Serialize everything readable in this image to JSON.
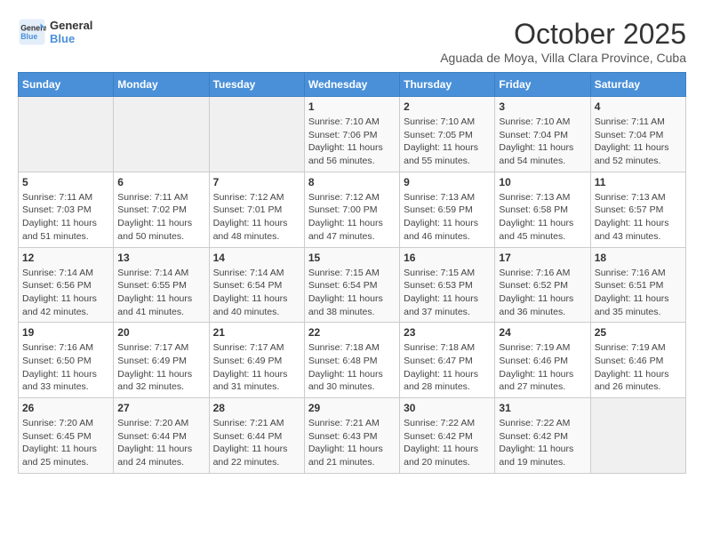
{
  "header": {
    "logo_line1": "General",
    "logo_line2": "Blue",
    "month": "October 2025",
    "location": "Aguada de Moya, Villa Clara Province, Cuba"
  },
  "weekdays": [
    "Sunday",
    "Monday",
    "Tuesday",
    "Wednesday",
    "Thursday",
    "Friday",
    "Saturday"
  ],
  "weeks": [
    [
      {
        "day": "",
        "info": ""
      },
      {
        "day": "",
        "info": ""
      },
      {
        "day": "",
        "info": ""
      },
      {
        "day": "1",
        "info": "Sunrise: 7:10 AM\nSunset: 7:06 PM\nDaylight: 11 hours\nand 56 minutes."
      },
      {
        "day": "2",
        "info": "Sunrise: 7:10 AM\nSunset: 7:05 PM\nDaylight: 11 hours\nand 55 minutes."
      },
      {
        "day": "3",
        "info": "Sunrise: 7:10 AM\nSunset: 7:04 PM\nDaylight: 11 hours\nand 54 minutes."
      },
      {
        "day": "4",
        "info": "Sunrise: 7:11 AM\nSunset: 7:04 PM\nDaylight: 11 hours\nand 52 minutes."
      }
    ],
    [
      {
        "day": "5",
        "info": "Sunrise: 7:11 AM\nSunset: 7:03 PM\nDaylight: 11 hours\nand 51 minutes."
      },
      {
        "day": "6",
        "info": "Sunrise: 7:11 AM\nSunset: 7:02 PM\nDaylight: 11 hours\nand 50 minutes."
      },
      {
        "day": "7",
        "info": "Sunrise: 7:12 AM\nSunset: 7:01 PM\nDaylight: 11 hours\nand 48 minutes."
      },
      {
        "day": "8",
        "info": "Sunrise: 7:12 AM\nSunset: 7:00 PM\nDaylight: 11 hours\nand 47 minutes."
      },
      {
        "day": "9",
        "info": "Sunrise: 7:13 AM\nSunset: 6:59 PM\nDaylight: 11 hours\nand 46 minutes."
      },
      {
        "day": "10",
        "info": "Sunrise: 7:13 AM\nSunset: 6:58 PM\nDaylight: 11 hours\nand 45 minutes."
      },
      {
        "day": "11",
        "info": "Sunrise: 7:13 AM\nSunset: 6:57 PM\nDaylight: 11 hours\nand 43 minutes."
      }
    ],
    [
      {
        "day": "12",
        "info": "Sunrise: 7:14 AM\nSunset: 6:56 PM\nDaylight: 11 hours\nand 42 minutes."
      },
      {
        "day": "13",
        "info": "Sunrise: 7:14 AM\nSunset: 6:55 PM\nDaylight: 11 hours\nand 41 minutes."
      },
      {
        "day": "14",
        "info": "Sunrise: 7:14 AM\nSunset: 6:54 PM\nDaylight: 11 hours\nand 40 minutes."
      },
      {
        "day": "15",
        "info": "Sunrise: 7:15 AM\nSunset: 6:54 PM\nDaylight: 11 hours\nand 38 minutes."
      },
      {
        "day": "16",
        "info": "Sunrise: 7:15 AM\nSunset: 6:53 PM\nDaylight: 11 hours\nand 37 minutes."
      },
      {
        "day": "17",
        "info": "Sunrise: 7:16 AM\nSunset: 6:52 PM\nDaylight: 11 hours\nand 36 minutes."
      },
      {
        "day": "18",
        "info": "Sunrise: 7:16 AM\nSunset: 6:51 PM\nDaylight: 11 hours\nand 35 minutes."
      }
    ],
    [
      {
        "day": "19",
        "info": "Sunrise: 7:16 AM\nSunset: 6:50 PM\nDaylight: 11 hours\nand 33 minutes."
      },
      {
        "day": "20",
        "info": "Sunrise: 7:17 AM\nSunset: 6:49 PM\nDaylight: 11 hours\nand 32 minutes."
      },
      {
        "day": "21",
        "info": "Sunrise: 7:17 AM\nSunset: 6:49 PM\nDaylight: 11 hours\nand 31 minutes."
      },
      {
        "day": "22",
        "info": "Sunrise: 7:18 AM\nSunset: 6:48 PM\nDaylight: 11 hours\nand 30 minutes."
      },
      {
        "day": "23",
        "info": "Sunrise: 7:18 AM\nSunset: 6:47 PM\nDaylight: 11 hours\nand 28 minutes."
      },
      {
        "day": "24",
        "info": "Sunrise: 7:19 AM\nSunset: 6:46 PM\nDaylight: 11 hours\nand 27 minutes."
      },
      {
        "day": "25",
        "info": "Sunrise: 7:19 AM\nSunset: 6:46 PM\nDaylight: 11 hours\nand 26 minutes."
      }
    ],
    [
      {
        "day": "26",
        "info": "Sunrise: 7:20 AM\nSunset: 6:45 PM\nDaylight: 11 hours\nand 25 minutes."
      },
      {
        "day": "27",
        "info": "Sunrise: 7:20 AM\nSunset: 6:44 PM\nDaylight: 11 hours\nand 24 minutes."
      },
      {
        "day": "28",
        "info": "Sunrise: 7:21 AM\nSunset: 6:44 PM\nDaylight: 11 hours\nand 22 minutes."
      },
      {
        "day": "29",
        "info": "Sunrise: 7:21 AM\nSunset: 6:43 PM\nDaylight: 11 hours\nand 21 minutes."
      },
      {
        "day": "30",
        "info": "Sunrise: 7:22 AM\nSunset: 6:42 PM\nDaylight: 11 hours\nand 20 minutes."
      },
      {
        "day": "31",
        "info": "Sunrise: 7:22 AM\nSunset: 6:42 PM\nDaylight: 11 hours\nand 19 minutes."
      },
      {
        "day": "",
        "info": ""
      }
    ]
  ]
}
